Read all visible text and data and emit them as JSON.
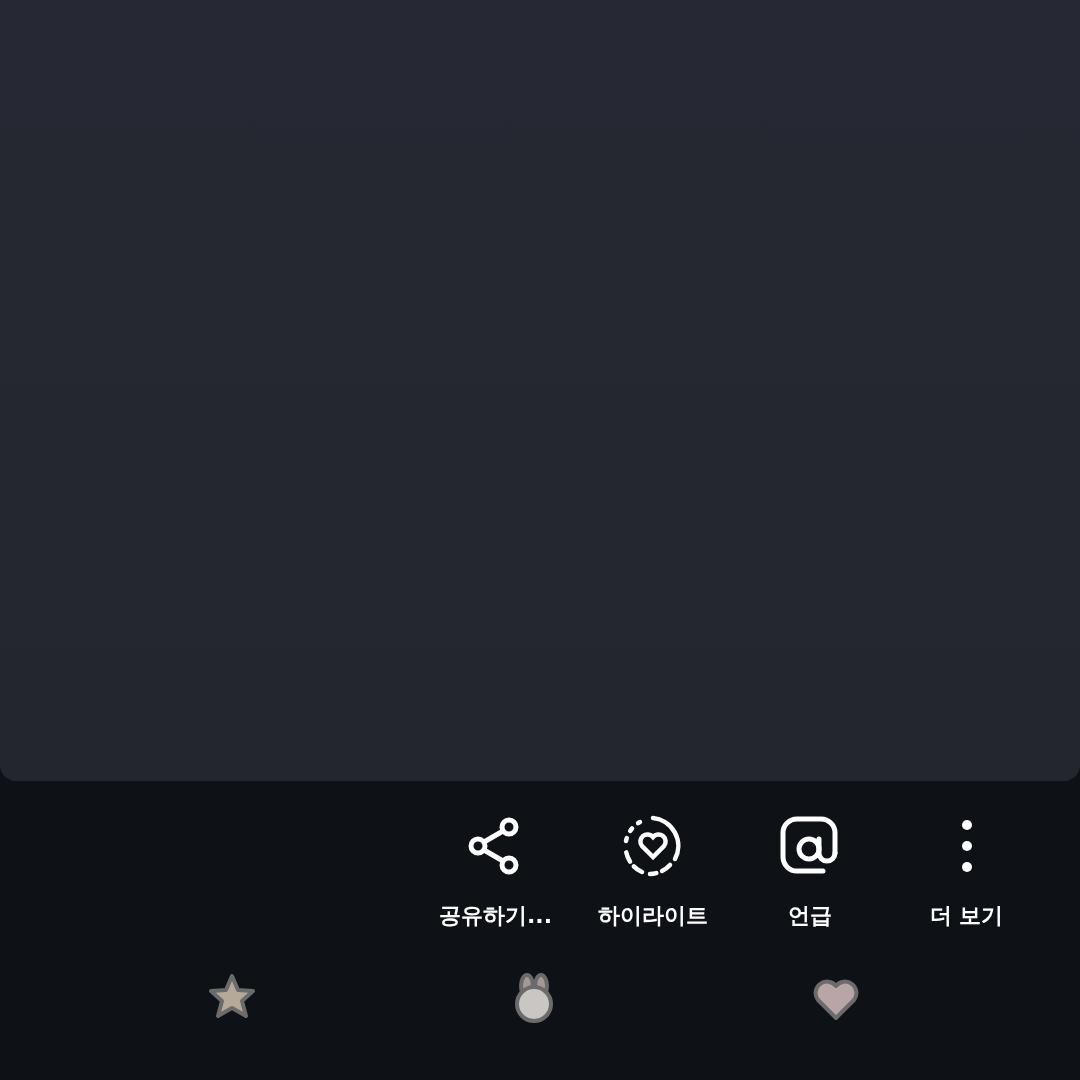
{
  "actions": [
    {
      "kind": "share",
      "label": "공유하기..."
    },
    {
      "kind": "highlight",
      "label": "하이라이트"
    },
    {
      "kind": "mention",
      "label": "언급"
    },
    {
      "kind": "more",
      "label": "더 보기"
    }
  ],
  "stickers": [
    {
      "kind": "star"
    },
    {
      "kind": "bunny"
    },
    {
      "kind": "heart"
    }
  ]
}
